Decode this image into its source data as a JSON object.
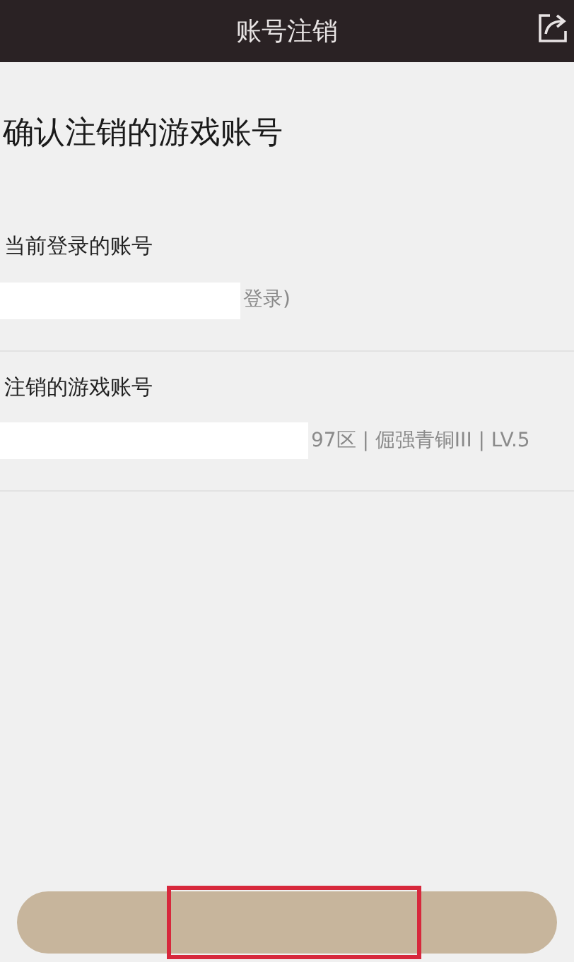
{
  "header": {
    "title": "账号注销"
  },
  "heading": "确认注销的游戏账号",
  "sections": [
    {
      "label": "当前登录的账号",
      "value": "登录)"
    },
    {
      "label": "注销的游戏账号",
      "value": "97区 | 倔强青铜III | LV.5"
    }
  ]
}
